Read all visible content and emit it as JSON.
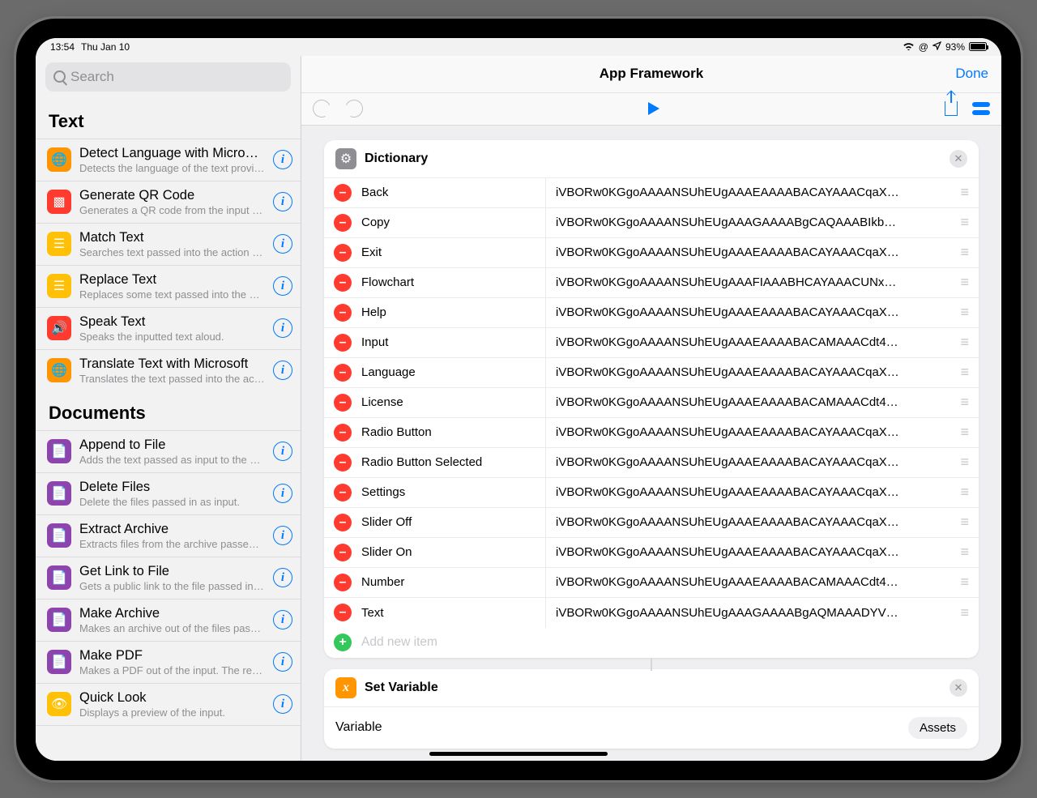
{
  "status": {
    "time": "13:54",
    "date": "Thu Jan 10",
    "battery": "93%"
  },
  "header": {
    "title": "App Framework",
    "done": "Done"
  },
  "search": {
    "placeholder": "Search"
  },
  "sections": [
    {
      "title": "Text",
      "items": [
        {
          "icon_name": "globe-icon",
          "color": "orange",
          "glyph": "🌐",
          "title": "Detect Language with Microsoft",
          "desc": "Detects the language of the text provided as…"
        },
        {
          "icon_name": "qr-icon",
          "color": "red",
          "glyph": "▩",
          "title": "Generate QR Code",
          "desc": "Generates a QR code from the input text."
        },
        {
          "icon_name": "lines-icon",
          "color": "yellow",
          "glyph": "☰",
          "title": "Match Text",
          "desc": "Searches text passed into the action for matc…"
        },
        {
          "icon_name": "lines-icon",
          "color": "yellow",
          "glyph": "☰",
          "title": "Replace Text",
          "desc": "Replaces some text passed into the action wi…"
        },
        {
          "icon_name": "speaker-icon",
          "color": "red",
          "glyph": "🔊",
          "title": "Speak Text",
          "desc": "Speaks the inputted text aloud."
        },
        {
          "icon_name": "globe-icon",
          "color": "orange",
          "glyph": "🌐",
          "title": "Translate Text with Microsoft",
          "desc": "Translates the text passed into the action int…"
        }
      ]
    },
    {
      "title": "Documents",
      "items": [
        {
          "icon_name": "file-icon",
          "color": "purple",
          "glyph": "📄",
          "title": "Append to File",
          "desc": "Adds the text passed as input to the end of t…"
        },
        {
          "icon_name": "file-icon",
          "color": "purple",
          "glyph": "📄",
          "title": "Delete Files",
          "desc": "Delete the files passed in as input."
        },
        {
          "icon_name": "file-icon",
          "color": "purple",
          "glyph": "📄",
          "title": "Extract Archive",
          "desc": "Extracts files from the archive passed as inp…"
        },
        {
          "icon_name": "file-icon",
          "color": "purple",
          "glyph": "📄",
          "title": "Get Link to File",
          "desc": "Gets a public link to the file passed into the a…"
        },
        {
          "icon_name": "file-icon",
          "color": "purple",
          "glyph": "📄",
          "title": "Make Archive",
          "desc": "Makes an archive out of the files passed as in…"
        },
        {
          "icon_name": "file-icon",
          "color": "purple",
          "glyph": "📄",
          "title": "Make PDF",
          "desc": "Makes a PDF out of the input. The resulting P…"
        },
        {
          "icon_name": "eye-icon",
          "color": "yellow",
          "glyph": "👁",
          "title": "Quick Look",
          "desc": "Displays a preview of the input."
        }
      ]
    }
  ],
  "dictionary": {
    "title": "Dictionary",
    "add_label": "Add new item",
    "rows": [
      {
        "key": "Back",
        "val": "iVBORw0KGgoAAAANSUhEUgAAAEAAAABACAYAAACqaX…"
      },
      {
        "key": "Copy",
        "val": "iVBORw0KGgoAAAANSUhEUgAAAGAAAABgCAQAAABIkb…"
      },
      {
        "key": "Exit",
        "val": "iVBORw0KGgoAAAANSUhEUgAAAEAAAABACAYAAACqaX…"
      },
      {
        "key": "Flowchart",
        "val": "iVBORw0KGgoAAAANSUhEUgAAAFIAAABHCAYAAACUNx…"
      },
      {
        "key": "Help",
        "val": "iVBORw0KGgoAAAANSUhEUgAAAEAAAABACAYAAACqaX…"
      },
      {
        "key": "Input",
        "val": "iVBORw0KGgoAAAANSUhEUgAAAEAAAABACAMAAACdt4…"
      },
      {
        "key": "Language",
        "val": "iVBORw0KGgoAAAANSUhEUgAAAEAAAABACAYAAACqaX…"
      },
      {
        "key": "License",
        "val": "iVBORw0KGgoAAAANSUhEUgAAAEAAAABACAMAAACdt4…"
      },
      {
        "key": "Radio Button",
        "val": "iVBORw0KGgoAAAANSUhEUgAAAEAAAABACAYAAACqaX…"
      },
      {
        "key": "Radio Button Selected",
        "val": "iVBORw0KGgoAAAANSUhEUgAAAEAAAABACAYAAACqaX…"
      },
      {
        "key": "Settings",
        "val": "iVBORw0KGgoAAAANSUhEUgAAAEAAAABACAYAAACqaX…"
      },
      {
        "key": "Slider Off",
        "val": "iVBORw0KGgoAAAANSUhEUgAAAEAAAABACAYAAACqaX…"
      },
      {
        "key": "Slider On",
        "val": "iVBORw0KGgoAAAANSUhEUgAAAEAAAABACAYAAACqaX…"
      },
      {
        "key": "Number",
        "val": "iVBORw0KGgoAAAANSUhEUgAAAEAAAABACAMAAACdt4…"
      },
      {
        "key": "Text",
        "val": "iVBORw0KGgoAAAANSUhEUgAAAGAAAABgAQMAAADYV…"
      }
    ]
  },
  "setvar": {
    "title": "Set Variable",
    "field": "Variable",
    "value": "Assets"
  }
}
